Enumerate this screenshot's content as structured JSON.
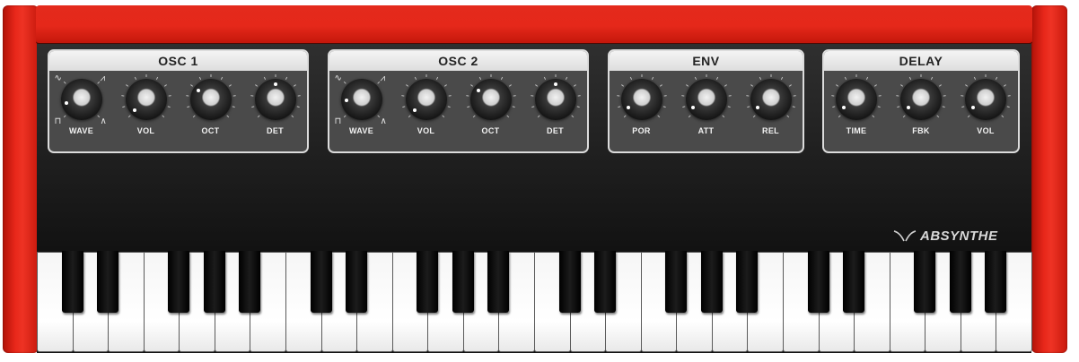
{
  "synth": {
    "brand": "ABSYNTHE",
    "modules": [
      {
        "title": "OSC 1",
        "knobs": [
          {
            "label": "WAVE",
            "value": 0.12,
            "selector": true
          },
          {
            "label": "VOL",
            "value": 0.0
          },
          {
            "label": "OCT",
            "value": 0.3
          },
          {
            "label": "DET",
            "value": 0.5
          }
        ]
      },
      {
        "title": "OSC 2",
        "knobs": [
          {
            "label": "WAVE",
            "value": 0.15,
            "selector": true
          },
          {
            "label": "VOL",
            "value": 0.0
          },
          {
            "label": "OCT",
            "value": 0.3
          },
          {
            "label": "DET",
            "value": 0.5
          }
        ]
      },
      {
        "title": "ENV",
        "knobs": [
          {
            "label": "POR",
            "value": 0.05
          },
          {
            "label": "ATT",
            "value": 0.05
          },
          {
            "label": "REL",
            "value": 0.05
          }
        ]
      },
      {
        "title": "DELAY",
        "knobs": [
          {
            "label": "TIME",
            "value": 0.05
          },
          {
            "label": "FBK",
            "value": 0.05
          },
          {
            "label": "VOL",
            "value": 0.05
          }
        ]
      }
    ],
    "wave_icons": [
      "sine-wave-icon",
      "sawtooth-wave-icon",
      "square-wave-icon",
      "triangle-wave-icon"
    ],
    "keyboard": {
      "white_key_count": 28,
      "black_key_count": 20
    },
    "colors": {
      "body_red": "#e5281a",
      "panel": "#1f1f1f",
      "knob_label": "#f2f2f2"
    }
  }
}
